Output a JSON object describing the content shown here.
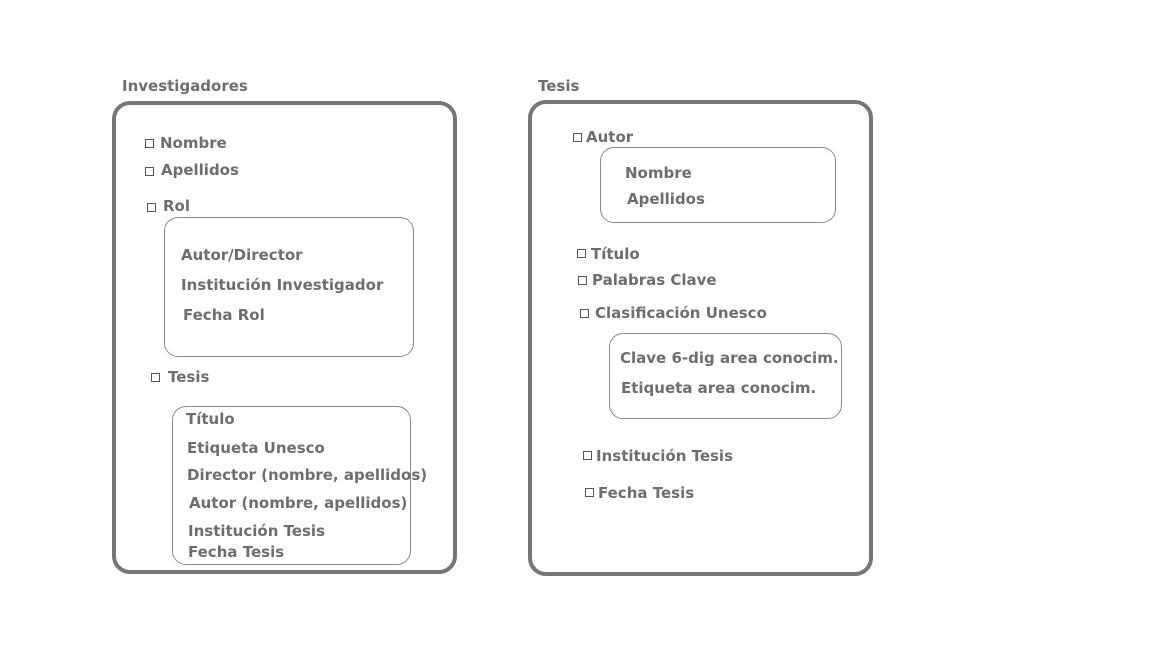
{
  "investigadores": {
    "title": "Investigadores",
    "fields": {
      "nombre": "Nombre",
      "apellidos": "Apellidos",
      "rol": "Rol",
      "tesis": "Tesis"
    },
    "rol_box": [
      "Autor/Director",
      "Institución Investigador",
      "Fecha Rol"
    ],
    "tesis_box": [
      "Título",
      "Etiqueta Unesco",
      "Director (nombre, apellidos)",
      "Autor (nombre, apellidos)",
      "Institución Tesis",
      "Fecha Tesis"
    ]
  },
  "tesis": {
    "title": "Tesis",
    "fields": {
      "autor": "Autor",
      "titulo": "Título",
      "palabras_clave": "Palabras Clave",
      "clasificacion": "Clasificación Unesco",
      "institucion": "Institución Tesis",
      "fecha": "Fecha Tesis"
    },
    "autor_box": [
      "Nombre",
      "Apellidos"
    ],
    "clasificacion_box": [
      "Clave 6-dig area conocim.",
      "Etiqueta area conocim."
    ]
  }
}
